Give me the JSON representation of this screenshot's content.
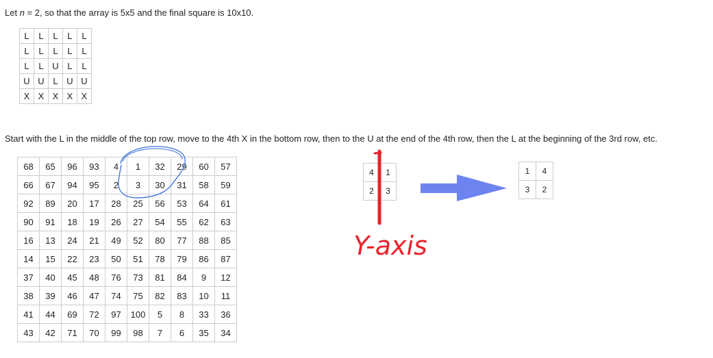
{
  "intro": {
    "before": "Let ",
    "var": "n",
    "after": " = 2, so that the array is 5x5 and the final square is 10x10."
  },
  "letter_grid": [
    [
      "L",
      "L",
      "L",
      "L",
      "L"
    ],
    [
      "L",
      "L",
      "L",
      "L",
      "L"
    ],
    [
      "L",
      "L",
      "U",
      "L",
      "L"
    ],
    [
      "U",
      "U",
      "L",
      "U",
      "U"
    ],
    [
      "X",
      "X",
      "X",
      "X",
      "X"
    ]
  ],
  "description": "Start with the L in the middle of the top row, move to the 4th X in the bottom row, then to the U at the end of the 4th row, then the L at the beginning of the 3rd row, etc.",
  "number_grid": [
    [
      "68",
      "65",
      "96",
      "93",
      "4",
      "1",
      "32",
      "29",
      "60",
      "57"
    ],
    [
      "66",
      "67",
      "94",
      "95",
      "2",
      "3",
      "30",
      "31",
      "58",
      "59"
    ],
    [
      "92",
      "89",
      "20",
      "17",
      "28",
      "25",
      "56",
      "53",
      "64",
      "61"
    ],
    [
      "90",
      "91",
      "18",
      "19",
      "26",
      "27",
      "54",
      "55",
      "62",
      "63"
    ],
    [
      "16",
      "13",
      "24",
      "21",
      "49",
      "52",
      "80",
      "77",
      "88",
      "85"
    ],
    [
      "14",
      "15",
      "22",
      "23",
      "50",
      "51",
      "78",
      "79",
      "86",
      "87"
    ],
    [
      "37",
      "40",
      "45",
      "48",
      "76",
      "73",
      "81",
      "84",
      "9",
      "12"
    ],
    [
      "38",
      "39",
      "46",
      "47",
      "74",
      "75",
      "82",
      "83",
      "10",
      "11"
    ],
    [
      "41",
      "44",
      "69",
      "72",
      "97",
      "100",
      "5",
      "8",
      "33",
      "36"
    ],
    [
      "43",
      "42",
      "71",
      "70",
      "99",
      "98",
      "7",
      "6",
      "35",
      "34"
    ]
  ],
  "small_left": [
    [
      "4",
      "1"
    ],
    [
      "2",
      "3"
    ]
  ],
  "small_right": [
    [
      "1",
      "4"
    ],
    [
      "3",
      "2"
    ]
  ],
  "annotation": {
    "label": "Y-axis",
    "ink_color": "#e8242c",
    "circle_color": "#3a6fd8",
    "arrow_color": "#6d84f0"
  }
}
